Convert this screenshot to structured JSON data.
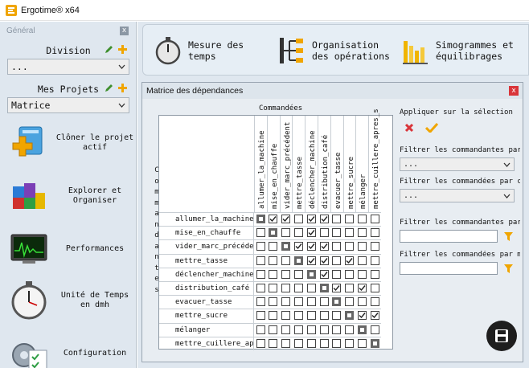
{
  "window": {
    "title": "Ergotime® x64"
  },
  "left_panel": {
    "header": "Général",
    "close": "x",
    "division_label": "Division",
    "division_value": "...",
    "projects_label": "Mes Projets",
    "projects_value": "Matrice",
    "nav": [
      {
        "label": "Clôner le projet actif",
        "icon": "clone-project-icon"
      },
      {
        "label": "Explorer et Organiser",
        "icon": "explore-organize-icon"
      },
      {
        "label": "Performances",
        "icon": "performance-monitor-icon"
      },
      {
        "label": "Unité de Temps en dmh",
        "icon": "stopwatch-icon"
      },
      {
        "label": "Configuration",
        "icon": "configuration-icon"
      }
    ]
  },
  "toolbar": {
    "items": [
      {
        "label_line1": "Mesure des",
        "label_line2": "temps",
        "icon": "stopwatch-icon"
      },
      {
        "label_line1": "Organisation",
        "label_line2": "des opérations",
        "icon": "operations-tree-icon"
      },
      {
        "label_line1": "Simogrammes et",
        "label_line2": "équilibrages",
        "icon": "bar-chart-icon"
      }
    ]
  },
  "matrix": {
    "title": "Matrice des dépendances",
    "close": "x",
    "columns_title": "Commandées",
    "rows_title": "Commandantes",
    "columns": [
      "allumer_la_machine",
      "mise_en_chauffe",
      "vider_marc_précédent",
      "mettre_tasse",
      "déclencher_machine",
      "distribution_café",
      "evacuer_tasse",
      "mettre_sucre",
      "mélanger",
      "mettre_cuillere_apres_s"
    ],
    "rows": [
      "allumer_la_machine",
      "mise_en_chauffe",
      "vider_marc_précéden",
      "mettre_tasse",
      "déclencher_machine",
      "distribution_café",
      "evacuer_tasse",
      "mettre_sucre",
      "mélanger",
      "mettre_cuillere_apr"
    ],
    "checked": [
      [
        0,
        1,
        1,
        0,
        1,
        1,
        0,
        0,
        0,
        0
      ],
      [
        0,
        0,
        0,
        0,
        1,
        0,
        0,
        0,
        0,
        0
      ],
      [
        0,
        0,
        0,
        1,
        1,
        1,
        0,
        0,
        0,
        0
      ],
      [
        0,
        0,
        0,
        0,
        1,
        1,
        0,
        1,
        0,
        0
      ],
      [
        0,
        0,
        0,
        0,
        0,
        1,
        0,
        0,
        0,
        0
      ],
      [
        0,
        0,
        0,
        0,
        0,
        0,
        1,
        0,
        1,
        0
      ],
      [
        0,
        0,
        0,
        0,
        0,
        0,
        0,
        0,
        0,
        0
      ],
      [
        0,
        0,
        0,
        0,
        0,
        0,
        0,
        0,
        1,
        1
      ],
      [
        0,
        0,
        0,
        0,
        0,
        0,
        0,
        0,
        0,
        0
      ],
      [
        0,
        0,
        0,
        0,
        0,
        0,
        0,
        0,
        0,
        0
      ]
    ]
  },
  "filters": {
    "apply_label": "Appliquer sur la sélection",
    "cat_cmd_label": "Filtrer les commandantes par cate",
    "cat_cmd_value": "...",
    "cat_cde_label": "Filtrer les commandées par catégo",
    "cat_cde_value": "...",
    "kw_cmd_label": "Filtrer les commandantes par mot",
    "kw_cde_label": "Filtrer les commandées par mot-cl"
  },
  "colors": {
    "accent": "#f0a500",
    "cancel": "#d9353a",
    "panel_bg": "#dfe7ef"
  }
}
